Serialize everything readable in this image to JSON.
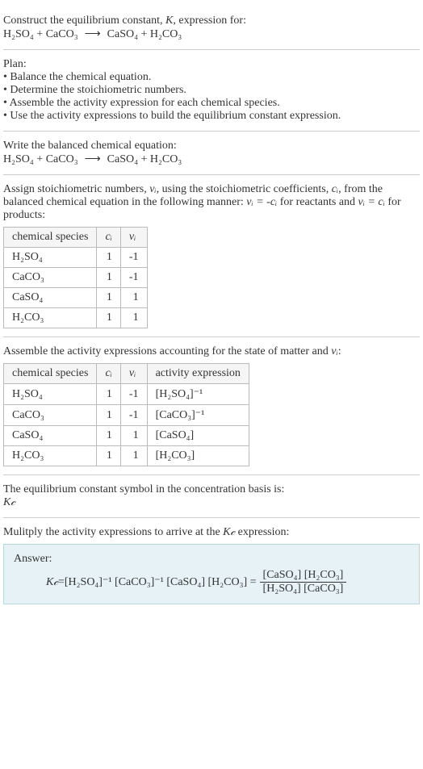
{
  "header": {
    "line1": "Construct the equilibrium constant, ",
    "kvar": "K",
    "line1b": ", expression for:"
  },
  "equation": {
    "lhs1": "H₂SO₄",
    "plus": " + ",
    "lhs2": "CaCO₃",
    "arrow": "⟶",
    "rhs1": "CaSO₄",
    "rhs2": "H₂CO₃"
  },
  "plan": {
    "title": "Plan:",
    "items": [
      "Balance the chemical equation.",
      "Determine the stoichiometric numbers.",
      "Assemble the activity expression for each chemical species.",
      "Use the activity expressions to build the equilibrium constant expression."
    ]
  },
  "balanced": {
    "title": "Write the balanced chemical equation:"
  },
  "stoich": {
    "intro1": "Assign stoichiometric numbers, ",
    "nu": "νᵢ",
    "intro2": ", using the stoichiometric coefficients, ",
    "ci": "cᵢ",
    "intro3": ", from the balanced chemical equation in the following manner: ",
    "rule1": "νᵢ = -cᵢ",
    "intro4": " for reactants and ",
    "rule2": "νᵢ = cᵢ",
    "intro5": " for products:",
    "headers": [
      "chemical species",
      "cᵢ",
      "νᵢ"
    ],
    "rows": [
      {
        "species": "H₂SO₄",
        "c": "1",
        "nu": "-1"
      },
      {
        "species": "CaCO₃",
        "c": "1",
        "nu": "-1"
      },
      {
        "species": "CaSO₄",
        "c": "1",
        "nu": "1"
      },
      {
        "species": "H₂CO₃",
        "c": "1",
        "nu": "1"
      }
    ]
  },
  "activity": {
    "intro1": "Assemble the activity expressions accounting for the state of matter and ",
    "nu": "νᵢ",
    "intro2": ":",
    "headers": [
      "chemical species",
      "cᵢ",
      "νᵢ",
      "activity expression"
    ],
    "rows": [
      {
        "species": "H₂SO₄",
        "c": "1",
        "nu": "-1",
        "expr": "[H₂SO₄]⁻¹"
      },
      {
        "species": "CaCO₃",
        "c": "1",
        "nu": "-1",
        "expr": "[CaCO₃]⁻¹"
      },
      {
        "species": "CaSO₄",
        "c": "1",
        "nu": "1",
        "expr": "[CaSO₄]"
      },
      {
        "species": "H₂CO₃",
        "c": "1",
        "nu": "1",
        "expr": "[H₂CO₃]"
      }
    ]
  },
  "symbol": {
    "line1": "The equilibrium constant symbol in the concentration basis is:",
    "kc": "K𝒸"
  },
  "multiply": {
    "line1": "Mulitply the activity expressions to arrive at the ",
    "kc": "K𝒸",
    "line2": " expression:"
  },
  "answer": {
    "label": "Answer:",
    "kc": "K𝒸",
    "eq": " = ",
    "terms": "[H₂SO₄]⁻¹ [CaCO₃]⁻¹ [CaSO₄] [H₂CO₃] = ",
    "num": "[CaSO₄] [H₂CO₃]",
    "den": "[H₂SO₄] [CaCO₃]"
  }
}
